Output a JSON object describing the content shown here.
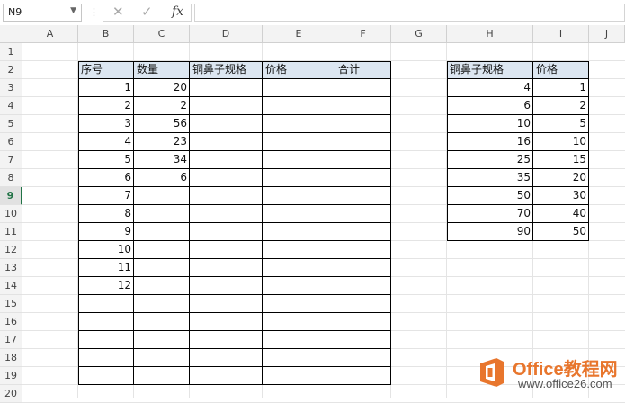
{
  "formula_bar": {
    "name_box": "N9",
    "separator": "⋮",
    "cancel_glyph": "✕",
    "enter_glyph": "✓",
    "fx_label": "fx",
    "formula": ""
  },
  "columns": [
    "A",
    "B",
    "C",
    "D",
    "E",
    "F",
    "G",
    "H",
    "I",
    "J"
  ],
  "rows": [
    "1",
    "2",
    "3",
    "4",
    "5",
    "6",
    "7",
    "8",
    "9",
    "10",
    "11",
    "12",
    "13",
    "14",
    "15",
    "16",
    "17",
    "18",
    "19",
    "20"
  ],
  "active_row": "9",
  "table1": {
    "headers": [
      "序号",
      "数量",
      "铜鼻子规格",
      "价格",
      "合计"
    ],
    "rows": [
      [
        "1",
        "20",
        "",
        "",
        ""
      ],
      [
        "2",
        "2",
        "",
        "",
        ""
      ],
      [
        "3",
        "56",
        "",
        "",
        ""
      ],
      [
        "4",
        "23",
        "",
        "",
        ""
      ],
      [
        "5",
        "34",
        "",
        "",
        ""
      ],
      [
        "6",
        "6",
        "",
        "",
        ""
      ],
      [
        "7",
        "",
        "",
        "",
        ""
      ],
      [
        "8",
        "",
        "",
        "",
        ""
      ],
      [
        "9",
        "",
        "",
        "",
        ""
      ],
      [
        "10",
        "",
        "",
        "",
        ""
      ],
      [
        "11",
        "",
        "",
        "",
        ""
      ],
      [
        "12",
        "",
        "",
        "",
        ""
      ],
      [
        "",
        "",
        "",
        "",
        ""
      ],
      [
        "",
        "",
        "",
        "",
        ""
      ],
      [
        "",
        "",
        "",
        "",
        ""
      ],
      [
        "",
        "",
        "",
        "",
        ""
      ],
      [
        "",
        "",
        "",
        "",
        ""
      ]
    ]
  },
  "table2": {
    "headers": [
      "铜鼻子规格",
      "价格"
    ],
    "rows": [
      [
        "4",
        "1"
      ],
      [
        "6",
        "2"
      ],
      [
        "10",
        "5"
      ],
      [
        "16",
        "10"
      ],
      [
        "25",
        "15"
      ],
      [
        "35",
        "20"
      ],
      [
        "50",
        "30"
      ],
      [
        "70",
        "40"
      ],
      [
        "90",
        "50"
      ]
    ]
  },
  "watermark": {
    "line1": "Office教程网",
    "line2": "www.office26.com"
  },
  "colors": {
    "header_fill": "#dce6f1",
    "active_row": "#217346",
    "brand_orange": "#e8762d"
  }
}
